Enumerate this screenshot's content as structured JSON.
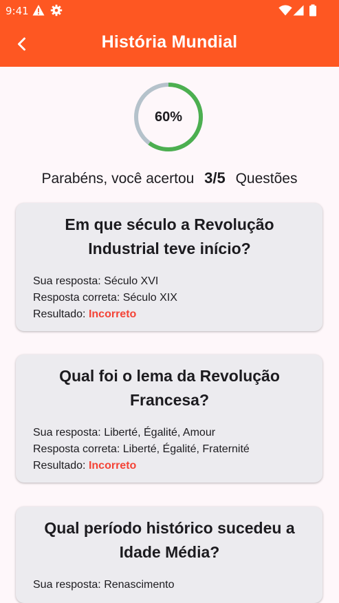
{
  "status_bar": {
    "time": "9:41"
  },
  "header": {
    "title": "História Mundial"
  },
  "progress": {
    "percent_label": "60%",
    "fraction": 0.6,
    "track_color": "#B5C2CB",
    "fill_color": "#4CAF50"
  },
  "score": {
    "prefix": "Parabéns, você acertou",
    "value": "3/5",
    "suffix": "Questões"
  },
  "results": [
    {
      "question": "Em que século a Revolução Industrial teve início?",
      "your_answer_label": "Sua resposta:",
      "your_answer": "Século XVI",
      "correct_answer_label": "Resposta correta:",
      "correct_answer": "Século XIX",
      "result_label": "Resultado:",
      "result": "Incorreto"
    },
    {
      "question": "Qual foi o lema da Revolução Francesa?",
      "your_answer_label": "Sua resposta:",
      "your_answer": "Liberté, Égalité, Amour",
      "correct_answer_label": "Resposta correta:",
      "correct_answer": "Liberté, Égalité, Fraternité",
      "result_label": "Resultado:",
      "result": "Incorreto"
    },
    {
      "question": "Qual período histórico sucedeu a Idade Média?",
      "your_answer_label": "Sua resposta:",
      "your_answer": "Renascimento"
    }
  ],
  "colors": {
    "app_bar": "#FE5722",
    "incorrect": "#F44336",
    "card_background": "#ECEBEF",
    "page_background": "#FEF7FA"
  }
}
